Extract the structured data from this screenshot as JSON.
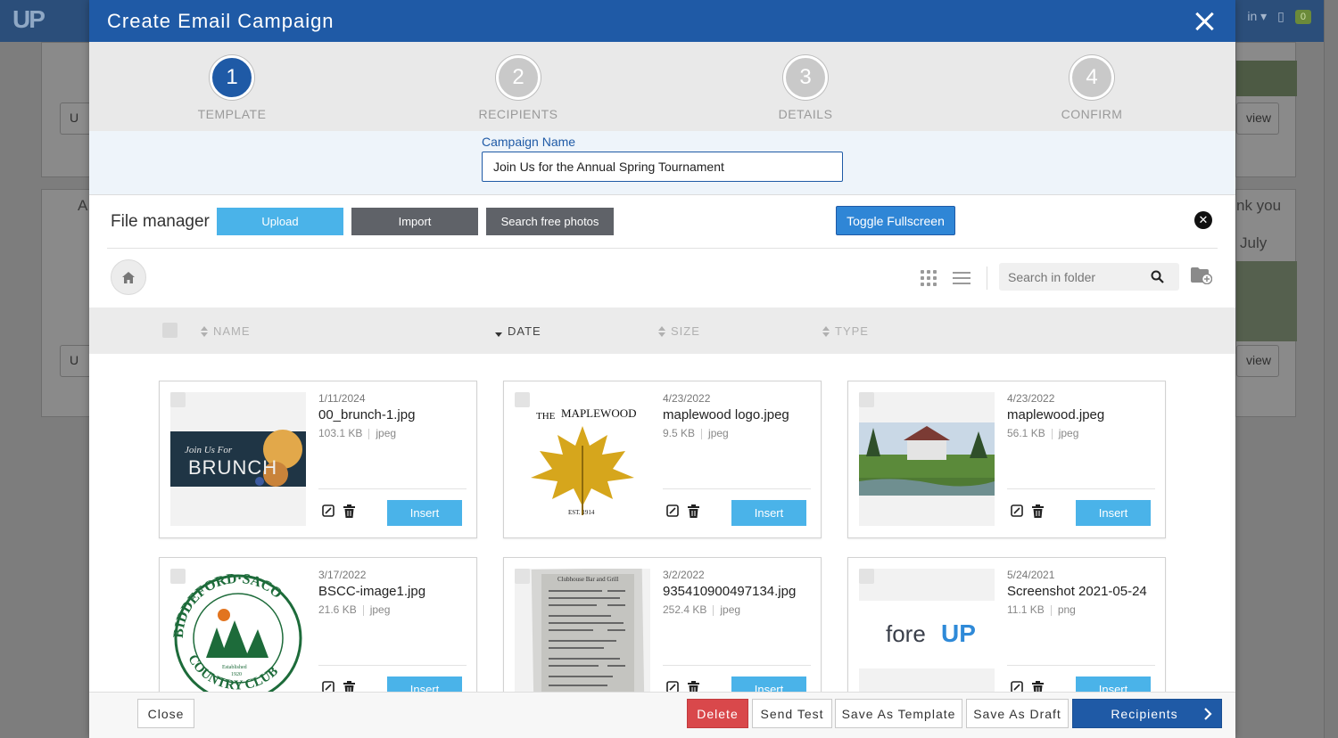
{
  "app": {
    "logo": "UP",
    "bg_right_partial": "in",
    "bg_badge": "0"
  },
  "background": {
    "btn_view_1": "view",
    "btn_view_2": "view",
    "text_thank": "nk you",
    "text_july": "July",
    "left_letter_a": "A",
    "left_letter_u1": "U",
    "left_letter_u2": "U"
  },
  "modal": {
    "title": "Create Email Campaign",
    "steps": [
      {
        "num": "1",
        "label": "TEMPLATE"
      },
      {
        "num": "2",
        "label": "RECIPIENTS"
      },
      {
        "num": "3",
        "label": "DETAILS"
      },
      {
        "num": "4",
        "label": "CONFIRM"
      }
    ],
    "active_step": 1,
    "campaign_name_label": "Campaign Name",
    "campaign_name_value": "Join Us for the Annual Spring Tournament"
  },
  "file_manager": {
    "title": "File manager",
    "upload_label": "Upload",
    "import_label": "Import",
    "search_free_label": "Search free photos",
    "toggle_label": "Toggle Fullscreen",
    "search_placeholder": "Search in folder",
    "columns": {
      "name": "NAME",
      "date": "DATE",
      "size": "SIZE",
      "type": "TYPE"
    },
    "insert_label": "Insert",
    "files": [
      {
        "date": "1/11/2024",
        "name": "00_brunch-1.jpg",
        "size": "103.1 KB",
        "type": "jpeg"
      },
      {
        "date": "4/23/2022",
        "name": "maplewood logo.jpeg",
        "size": "9.5 KB",
        "type": "jpeg"
      },
      {
        "date": "4/23/2022",
        "name": "maplewood.jpeg",
        "size": "56.1 KB",
        "type": "jpeg"
      },
      {
        "date": "3/17/2022",
        "name": "BSCC-image1.jpg",
        "size": "21.6 KB",
        "type": "jpeg"
      },
      {
        "date": "3/2/2022",
        "name": "935410900497134.jpg",
        "size": "252.4 KB",
        "type": "jpeg"
      },
      {
        "date": "5/24/2021",
        "name": "Screenshot 2021-05-24",
        "size": "11.1 KB",
        "type": "png"
      }
    ],
    "thumb_text": {
      "brunch_line1": "Join Us For",
      "brunch_line2": "BRUNCH",
      "maplewood_the": "THE",
      "maplewood_name": "MAPLEWOOD",
      "maplewood_est": "EST. 1914",
      "bscc_top": "BIDDEFORD·SACO",
      "bscc_bottom": "COUNTRY CLUB",
      "bscc_est": "Established",
      "bscc_year": "1920",
      "menu_title": "Clubhouse Bar and Grill",
      "foreup_fore": "fore",
      "foreup_up": "UP"
    }
  },
  "footer": {
    "close_label": "Close",
    "delete_label": "Delete",
    "send_test_label": "Send Test",
    "save_template_label": "Save As Template",
    "save_draft_label": "Save As Draft",
    "next_label": "Recipients"
  },
  "colors": {
    "primary": "#1f5aa6",
    "accent": "#4ab3e9",
    "danger": "#d9484b",
    "dark_button": "#5f6268"
  }
}
